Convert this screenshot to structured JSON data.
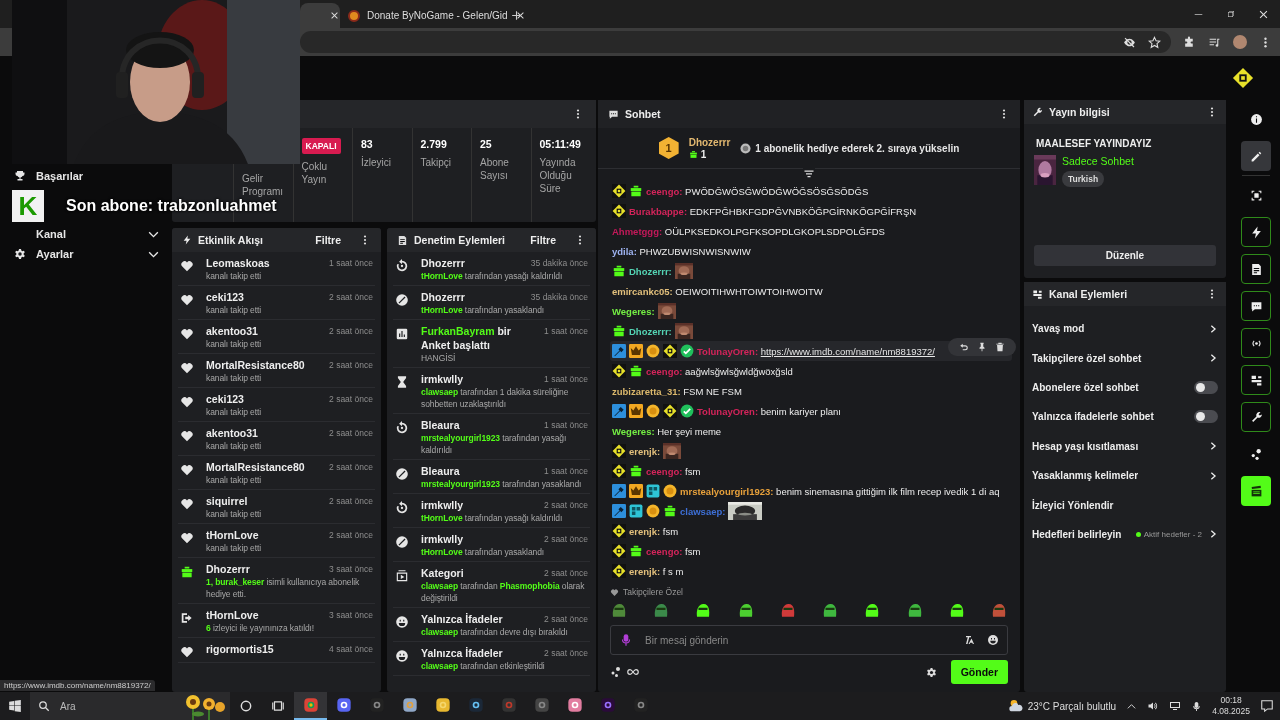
{
  "browser": {
    "tabs": [
      {
        "selected": true
      },
      {
        "title": "Donate ByNoGame - Gelen/Gid",
        "selected": false
      }
    ]
  },
  "overlay": {
    "logo": "K",
    "text": "Son abone: trabzonluahmet"
  },
  "sidebar": {
    "items": [
      {
        "label": "Başarılar",
        "kind": "link"
      },
      {
        "label": "Kanal",
        "kind": "group"
      },
      {
        "label": "Ayarlar",
        "kind": "group"
      }
    ]
  },
  "stats": {
    "cells": [
      {
        "label": "Gelir Programı"
      },
      {
        "badge": "KAPALI",
        "label": "Çoklu Yayın"
      },
      {
        "value": "83",
        "label": "İzleyici"
      },
      {
        "value": "2.799",
        "label": "Takipçi"
      },
      {
        "value": "25",
        "label": "Abone Sayısı"
      },
      {
        "value": "05:11:49",
        "label": "Yayında Olduğu Süre"
      }
    ]
  },
  "events": {
    "title": "Etkinlik Akışı",
    "filter": "Filtre",
    "items": [
      {
        "kind": "follow",
        "name": "Leomaskoas",
        "time": "1 saat önce",
        "detail": "kanalı takip etti"
      },
      {
        "kind": "follow",
        "name": "ceki123",
        "time": "2 saat önce",
        "detail": "kanalı takip etti"
      },
      {
        "kind": "follow",
        "name": "akentoo31",
        "time": "2 saat önce",
        "detail": "kanalı takip etti"
      },
      {
        "kind": "follow",
        "name": "MortalResistance80",
        "time": "2 saat önce",
        "detail": "kanalı takip etti"
      },
      {
        "kind": "follow",
        "name": "ceki123",
        "time": "2 saat önce",
        "detail": "kanalı takip etti"
      },
      {
        "kind": "follow",
        "name": "akentoo31",
        "time": "2 saat önce",
        "detail": "kanalı takip etti"
      },
      {
        "kind": "follow",
        "name": "MortalResistance80",
        "time": "2 saat önce",
        "detail": "kanalı takip etti"
      },
      {
        "kind": "follow",
        "name": "siquirrel",
        "time": "2 saat önce",
        "detail": "kanalı takip etti"
      },
      {
        "kind": "follow",
        "name": "tHornLove",
        "time": "2 saat önce",
        "detail": "kanalı takip etti"
      },
      {
        "kind": "gift",
        "name": "Dhozerrr",
        "time": "3 saat önce",
        "detail": "**1, burak_keser** isimli kullanıcıya abonelik hediye etti."
      },
      {
        "kind": "host",
        "name": "tHornLove",
        "time": "3 saat önce",
        "detail": "**6** izleyici ile yayınınıza katıldı!"
      },
      {
        "kind": "follow",
        "name": "rigormortis15",
        "time": "4 saat önce"
      }
    ]
  },
  "moderation": {
    "title": "Denetim Eylemleri",
    "filter": "Filtre",
    "items": [
      {
        "kind": "unban",
        "name": "Dhozerrr",
        "time": "35 dakika önce",
        "detail": "**tHornLove** tarafından yasağı kaldırıldı"
      },
      {
        "kind": "ban",
        "name": "Dhozerrr",
        "time": "35 dakika önce",
        "detail": "**tHornLove** tarafından yasaklandı"
      },
      {
        "kind": "poll",
        "name": "**FurkanBayram** bir Anket başlattı",
        "time": "1 saat önce",
        "detail": "HANGİSİ"
      },
      {
        "kind": "timeout",
        "name": "irmkwlly",
        "time": "1 saat önce",
        "detail": "**clawsaep** tarafından 1 dakika süreliğine sohbetten uzaklaştırıldı"
      },
      {
        "kind": "unban",
        "name": "Bleaura",
        "time": "1 saat önce",
        "detail": "**mrstealyourgirl1923** tarafından yasağı kaldırıldı"
      },
      {
        "kind": "ban",
        "name": "Bleaura",
        "time": "1 saat önce",
        "detail": "**mrstealyourgirl1923** tarafından yasaklandı"
      },
      {
        "kind": "unban",
        "name": "irmkwlly",
        "time": "2 saat önce",
        "detail": "**tHornLove** tarafından yasağı kaldırıldı"
      },
      {
        "kind": "ban",
        "name": "irmkwlly",
        "time": "2 saat önce",
        "detail": "**tHornLove** tarafından yasaklandı"
      },
      {
        "kind": "category",
        "name": "Kategori",
        "time": "2 saat önce",
        "detail": "**clawsaep** tarafından **Phasmophobia** olarak değiştirildi"
      },
      {
        "kind": "emote",
        "name": "Yalnızca İfadeler",
        "time": "2 saat önce",
        "detail": "**clawsaep** tarafından devre dışı bırakıldı"
      },
      {
        "kind": "emote",
        "name": "Yalnızca İfadeler",
        "time": "2 saat önce",
        "detail": "**clawsaep** tarafından etkinleştirildi"
      }
    ]
  },
  "chat": {
    "title": "Sohbet",
    "leader": {
      "rank": "1",
      "name": "Dhozerrr",
      "count": "1",
      "hint": "1 abonelik hediye ederek 2. sıraya yükselin"
    },
    "messages": [
      {
        "badges": [
          {
            "kind": "kick"
          },
          {
            "kind": "gift"
          }
        ],
        "user": "ceengo:",
        "color": "#d3245a",
        "kind": "text",
        "text": "PWÖDĞWÖSĞWÖDĞWÖĞSÖSĞSÖDĞS",
        "hovered": false
      },
      {
        "badges": [
          {
            "kind": "kick"
          }
        ],
        "user": "Burakbappe:",
        "color": "#d3245a",
        "kind": "text",
        "text": "EDKFPĞHBKFGDPĞVNBKÖĞPGİRNKÖGPĞİFRŞN",
        "hovered": false
      },
      {
        "user": "Ahmetggg:",
        "color": "#c4195a",
        "kind": "text",
        "text": "OÜLPKSEDKOLPGFKSOPDLGKOPLSDPOLĞFDS",
        "hovered": false
      },
      {
        "user": "ydila:",
        "color": "#9fb4f2",
        "kind": "text",
        "text": "PHWZUBWISNWISNWIW",
        "hovered": false
      },
      {
        "badges": [
          {
            "kind": "gift"
          }
        ],
        "user": "Dhozerrr:",
        "color": "#54d4b4",
        "kind": "emote",
        "hovered": false
      },
      {
        "user": "emircankc05:",
        "color": "#e3c07c",
        "kind": "text",
        "text": "OEIWOITIHWHTOIWTOIHWOITW",
        "hovered": false
      },
      {
        "user": "Wegeres:",
        "color": "#74ef43",
        "kind": "emote",
        "hovered": false
      },
      {
        "badges": [
          {
            "kind": "gift"
          }
        ],
        "user": "Dhozerrr:",
        "color": "#54d4b4",
        "kind": "emote",
        "hovered": false
      },
      {
        "badges": [
          {
            "kind": "mod"
          },
          {
            "kind": "vip"
          },
          {
            "kind": "sub"
          },
          {
            "kind": "kick"
          },
          {
            "kind": "verified"
          }
        ],
        "user": "TolunayOren:",
        "color": "#d3245a",
        "kind": "link",
        "text": "https://www.imdb.com/name/nm8819372/",
        "hovered": true
      },
      {
        "badges": [
          {
            "kind": "kick"
          },
          {
            "kind": "gift"
          }
        ],
        "user": "ceengo:",
        "color": "#d3245a",
        "kind": "text",
        "text": "aağwlsğwlsğwldğwöxğsld",
        "hovered": false
      },
      {
        "user": "zubizaretta_31:",
        "color": "#dbb86c",
        "kind": "text",
        "text": "FSM NE FSM",
        "hovered": false
      },
      {
        "badges": [
          {
            "kind": "mod"
          },
          {
            "kind": "vip"
          },
          {
            "kind": "sub"
          },
          {
            "kind": "kick"
          },
          {
            "kind": "verified"
          }
        ],
        "user": "TolunayOren:",
        "color": "#d3245a",
        "kind": "text",
        "text": "benim kariyer planı",
        "hovered": false
      },
      {
        "user": "Wegeres:",
        "color": "#74ef43",
        "kind": "text",
        "text": "Her şeyi meme",
        "hovered": false
      },
      {
        "badges": [
          {
            "kind": "kick"
          }
        ],
        "user": "erenjk:",
        "color": "#e3c07c",
        "kind": "emote",
        "hovered": false
      },
      {
        "badges": [
          {
            "kind": "kick"
          },
          {
            "kind": "gift"
          }
        ],
        "user": "ceengo:",
        "color": "#d3245a",
        "kind": "text",
        "text": "fsm",
        "hovered": false
      },
      {
        "badges": [
          {
            "kind": "mod"
          },
          {
            "kind": "vip"
          },
          {
            "kind": "og"
          },
          {
            "kind": "sub"
          }
        ],
        "user": "mrstealyourgirl1923:",
        "color": "#e9a23b",
        "kind": "text",
        "text": "benim sinemasına gittiğim ilk film recep ivedik 1 di aq",
        "hovered": false
      },
      {
        "badges": [
          {
            "kind": "mod"
          },
          {
            "kind": "og"
          },
          {
            "kind": "sub"
          },
          {
            "kind": "gift"
          }
        ],
        "user": "clawsaep:",
        "color": "#3d6fd6",
        "hovered": false
      },
      {
        "badges": [
          {
            "kind": "kick"
          }
        ],
        "user": "erenjk:",
        "color": "#e3c07c",
        "kind": "text",
        "text": "fsm",
        "hovered": false
      },
      {
        "badges": [
          {
            "kind": "kick"
          },
          {
            "kind": "gift"
          }
        ],
        "user": "ceengo:",
        "color": "#d3245a",
        "kind": "text",
        "text": "fsm",
        "hovered": false
      },
      {
        "badges": [
          {
            "kind": "kick"
          }
        ],
        "user": "erenjk:",
        "color": "#e3c07c",
        "kind": "text",
        "text": "f s m",
        "hovered": false
      }
    ],
    "emote_section": "Takipçilere Özel",
    "input": {
      "placeholder": "Bir mesaj gönderin"
    },
    "send": "Gönder"
  },
  "stream_info": {
    "title": "Yayın bilgisi",
    "stream_title": "MAALESEF YAYINDAYIZ",
    "category": "Sadece Sohbet",
    "tag": "Turkish",
    "edit": "Düzenle"
  },
  "channel_actions": {
    "title": "Kanal Eylemleri",
    "items": [
      {
        "kind": "link",
        "label": "Yavaş mod"
      },
      {
        "kind": "link",
        "label": "Takipçilere özel sohbet"
      },
      {
        "kind": "toggle",
        "label": "Abonelere özel sohbet",
        "on": false
      },
      {
        "kind": "toggle",
        "label": "Yalnızca ifadelerle sohbet",
        "on": false
      },
      {
        "kind": "link",
        "label": "Hesap yaşı kısıtlaması"
      },
      {
        "kind": "link",
        "label": "Yasaklanmış kelimeler"
      },
      {
        "kind": "plain",
        "label": "İzleyici Yönlendir"
      },
      {
        "kind": "link",
        "label": "Hedefleri belirleyin",
        "status": "Aktif hedefler - 2"
      }
    ]
  },
  "rail": {
    "items": [
      {
        "kind": "button",
        "selected": false
      },
      {
        "kind": "button",
        "selected": true
      },
      {
        "kind": "button",
        "selected": false
      },
      {
        "kind": "toggle",
        "on": true
      },
      {
        "kind": "toggle",
        "on": true
      },
      {
        "kind": "toggle",
        "on": true
      },
      {
        "kind": "toggle",
        "on": true
      },
      {
        "kind": "toggle",
        "on": true
      },
      {
        "kind": "toggle",
        "on": true
      },
      {
        "kind": "button",
        "selected": false
      },
      {
        "kind": "launcher"
      }
    ]
  },
  "status_url": "https://www.imdb.com/name/nm8819372/",
  "taskbar": {
    "search": {
      "placeholder": "Ara"
    },
    "apps": [
      {
        "selected": true
      },
      {
        "selected": false
      },
      {
        "selected": false
      },
      {
        "selected": false
      },
      {
        "selected": false
      },
      {
        "selected": false
      },
      {
        "selected": false
      },
      {
        "selected": false
      },
      {
        "selected": false
      },
      {
        "selected": false
      },
      {
        "selected": false
      }
    ],
    "weather": "23°C Parçalı bulutlu",
    "time": "00:18",
    "date": "4.08.2025"
  }
}
